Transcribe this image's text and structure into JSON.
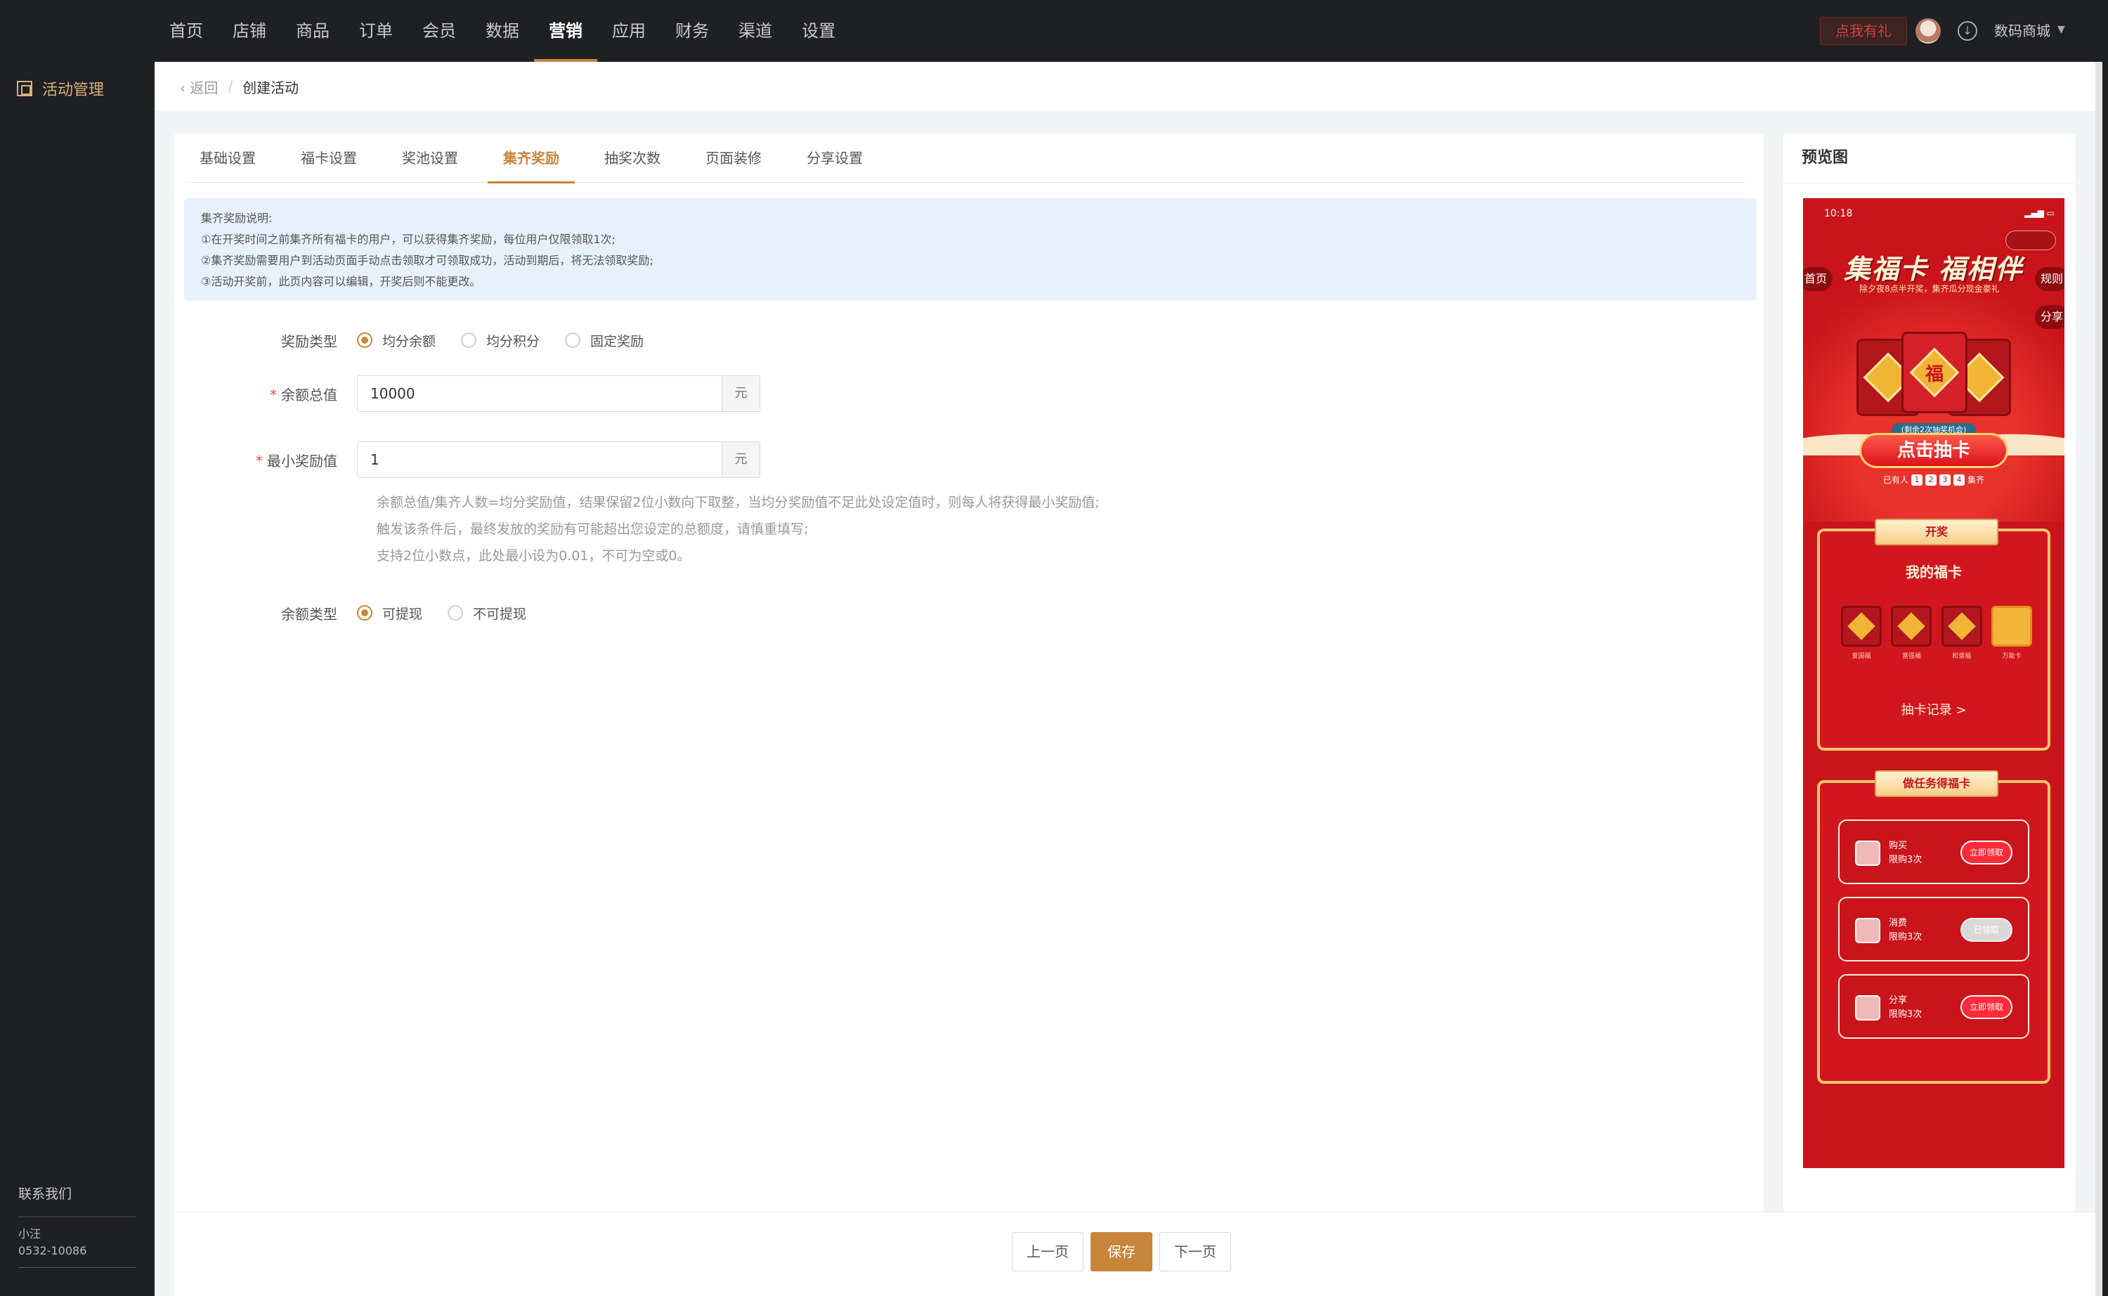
{
  "topnav": {
    "items": [
      "首页",
      "店铺",
      "商品",
      "订单",
      "会员",
      "数据",
      "营销",
      "应用",
      "财务",
      "渠道",
      "设置"
    ],
    "active": "营销"
  },
  "header_right": {
    "promo": "点我有礼",
    "store": "数码商城"
  },
  "sidebar": {
    "item": "活动管理",
    "contact_title": "联系我们",
    "contact_name": "小汪",
    "contact_phone": "0532-10086"
  },
  "breadcrumb": {
    "back": "返回",
    "separator": "/",
    "current": "创建活动"
  },
  "tabs": [
    "基础设置",
    "福卡设置",
    "奖池设置",
    "集齐奖励",
    "抽奖次数",
    "页面装修",
    "分享设置"
  ],
  "active_tab": "集齐奖励",
  "notice": {
    "title": "集齐奖励说明:",
    "lines": [
      "①在开奖时间之前集齐所有福卡的用户，可以获得集齐奖励，每位用户仅限领取1次;",
      "②集齐奖励需要用户到活动页面手动点击领取才可领取成功，活动到期后，将无法领取奖励;",
      "③活动开奖前，此页内容可以编辑，开奖后则不能更改。"
    ]
  },
  "form": {
    "reward_type": {
      "label": "奖励类型",
      "options": [
        "均分余额",
        "均分积分",
        "固定奖励"
      ],
      "selected": "均分余额"
    },
    "total_amount": {
      "label": "余额总值",
      "value": "10000",
      "unit": "元"
    },
    "min_reward": {
      "label": "最小奖励值",
      "value": "1",
      "unit": "元"
    },
    "hints": [
      "余额总值/集齐人数=均分奖励值，结果保留2位小数向下取整，当均分奖励值不足此处设定值时，则每人将获得最小奖励值;",
      "触发该条件后，最终发放的奖励有可能超出您设定的总额度，请慎重填写;",
      "支持2位小数点，此处最小设为0.01，不可为空或0。"
    ],
    "balance_type": {
      "label": "余额类型",
      "options": [
        "可提现",
        "不可提现"
      ],
      "selected": "可提现"
    }
  },
  "footer": {
    "prev": "上一页",
    "save": "保存",
    "next": "下一页"
  },
  "preview": {
    "title": "预览图",
    "time": "10:18",
    "hero_title": "集福卡 福相伴",
    "hero_sub": "除夕夜8点半开奖，集齐瓜分现金豪礼",
    "left_pill": "首页",
    "right_pill_1": "规则",
    "right_pill_2": "分享",
    "fu_char": "福",
    "chance": "(剩余2次抽奖机会)",
    "draw_button": "点击抽卡",
    "collected_prefix": "已有人",
    "collected_digits": [
      "1",
      "2",
      "3",
      "4"
    ],
    "collected_suffix": "集齐",
    "panel1_ribbon": "开奖",
    "panel1_heading": "我的福卡",
    "fu_cards": [
      "爱国福",
      "富强福",
      "和谐福",
      "万能卡"
    ],
    "panel1_link": "抽卡记录 >",
    "panel2_ribbon": "做任务得福卡",
    "tasks": [
      {
        "name": "购买",
        "limit": "限购3次",
        "button": "立即领取",
        "done": false
      },
      {
        "name": "消费",
        "limit": "限购3次",
        "button": "已领取",
        "done": true
      },
      {
        "name": "分享",
        "limit": "限购3次",
        "button": "立即领取",
        "done": false
      }
    ]
  },
  "colors": {
    "accent": "#c8863a",
    "topbar_bg": "#1f2024",
    "preview_red": "#c8141a"
  }
}
